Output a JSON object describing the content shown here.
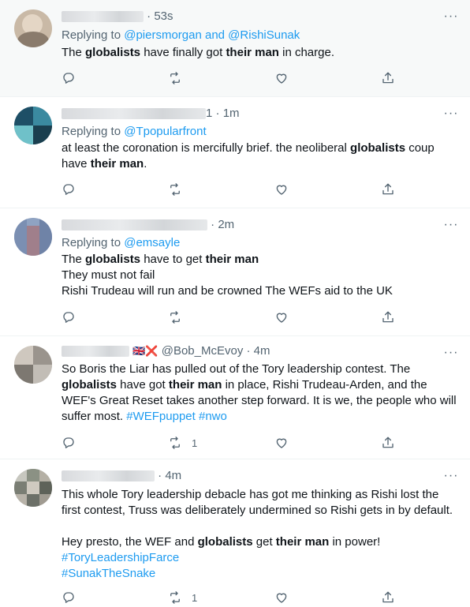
{
  "tweets": [
    {
      "time": "53s",
      "reply_prefix": "Replying to",
      "reply_to": "@piersmorgan and @RishiSunak",
      "text_parts": [
        {
          "t": "The ",
          "b": false
        },
        {
          "t": "globalists",
          "b": true
        },
        {
          "t": " have finally got ",
          "b": false
        },
        {
          "t": "their man",
          "b": true
        },
        {
          "t": " in charge.",
          "b": false
        }
      ],
      "retweets": "",
      "likes": ""
    },
    {
      "time": "1m",
      "handle_suffix": "1",
      "reply_prefix": "Replying to",
      "reply_to": "@Tpopularfront",
      "line1": "at least the coronation is mercifully brief. the neoliberal ",
      "bold1": "globalists",
      "line1_end": " coup",
      "line2_pre": "have ",
      "bold2": "their man",
      "line2_end": "."
    },
    {
      "time": "2m",
      "reply_prefix": "Replying to",
      "reply_to": "@emsayle",
      "l1_pre": "The ",
      "l1_b1": "globalists",
      "l1_mid": " have to get ",
      "l1_b2": "their man",
      "l2": "They must not fail",
      "l3": "Rishi Trudeau will run and be crowned The WEFs aid to the UK"
    },
    {
      "time": "4m",
      "handle": "@Bob_McEvoy",
      "flag_uk": "🇬🇧",
      "flag_x": "❌",
      "l1": "So Boris the Liar has pulled out of the Tory leadership contest. The",
      "l2_b1": "globalists",
      "l2_mid": " have got ",
      "l2_b2": "their man",
      "l2_end": " in place, Rishi Trudeau-Arden, and the",
      "l3": "WEF's Great Reset takes another step forward. It is we, the people who will",
      "l4_pre": "suffer most. ",
      "tag1": "#WEFpuppet",
      "tag2": "#nwo",
      "retweets": "1"
    },
    {
      "time": "4m",
      "l1": "This whole Tory leadership debacle has got me thinking as Rishi lost the",
      "l2": "first contest, Truss was deliberately undermined so Rishi gets in by default.",
      "l3_pre": "Hey presto, the WEF and ",
      "l3_b1": "globalists",
      "l3_mid": " get ",
      "l3_b2": "their man",
      "l3_end": " in power!",
      "tag1": "#ToryLeadershipFarce",
      "tag2": "#SunakTheSnake",
      "retweets": "1"
    }
  ],
  "ui": {
    "sep": "·",
    "more": "···"
  },
  "colors": {
    "accent": "#1d9bf0",
    "muted": "#536471",
    "text": "#0f1419",
    "highlight_bg": "#f7f9f9"
  }
}
